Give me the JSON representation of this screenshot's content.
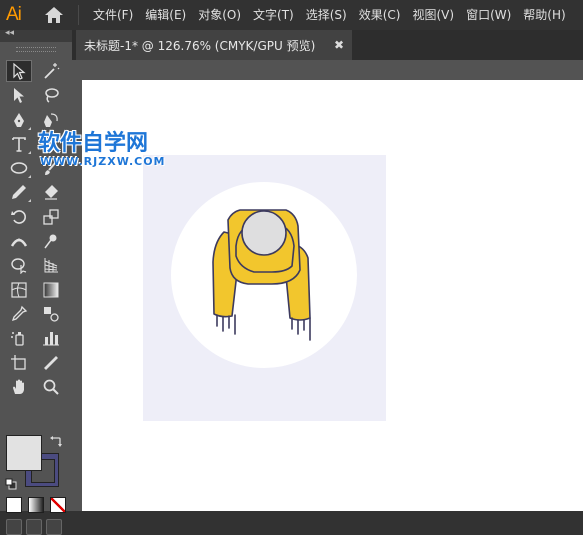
{
  "app": {
    "logo": "Ai",
    "colors": {
      "logo": "#ff9a00",
      "selection": "#4b4b80"
    }
  },
  "menu": [
    {
      "label": "文件(F)",
      "name": "menu-file"
    },
    {
      "label": "编辑(E)",
      "name": "menu-edit"
    },
    {
      "label": "对象(O)",
      "name": "menu-object"
    },
    {
      "label": "文字(T)",
      "name": "menu-type"
    },
    {
      "label": "选择(S)",
      "name": "menu-select"
    },
    {
      "label": "效果(C)",
      "name": "menu-effect"
    },
    {
      "label": "视图(V)",
      "name": "menu-view"
    },
    {
      "label": "窗口(W)",
      "name": "menu-window"
    },
    {
      "label": "帮助(H)",
      "name": "menu-help"
    }
  ],
  "document": {
    "tab_title": "未标题-1* @ 126.76% (CMYK/GPU 预览)",
    "close_glyph": "✖"
  },
  "tools_panel": {
    "collapse_glyph": "◂◂",
    "tools": [
      "selection-tool",
      "magic-wand-tool",
      "direct-selection-tool",
      "lasso-tool",
      "pen-tool",
      "curvature-tool",
      "type-tool",
      "line-segment-tool",
      "ellipse-tool",
      "paintbrush-tool",
      "pencil-tool",
      "eraser-tool",
      "rotate-tool",
      "scale-tool",
      "width-tool",
      "puppet-warp-tool",
      "shape-builder-tool",
      "perspective-grid-tool",
      "mesh-tool",
      "gradient-tool",
      "eyedropper-tool",
      "blend-tool",
      "symbol-sprayer-tool",
      "column-graph-tool",
      "artboard-tool",
      "slice-tool",
      "hand-tool",
      "zoom-tool"
    ]
  },
  "watermark": {
    "title": "软件自学网",
    "url": "WWW.RJZXW.COM"
  }
}
